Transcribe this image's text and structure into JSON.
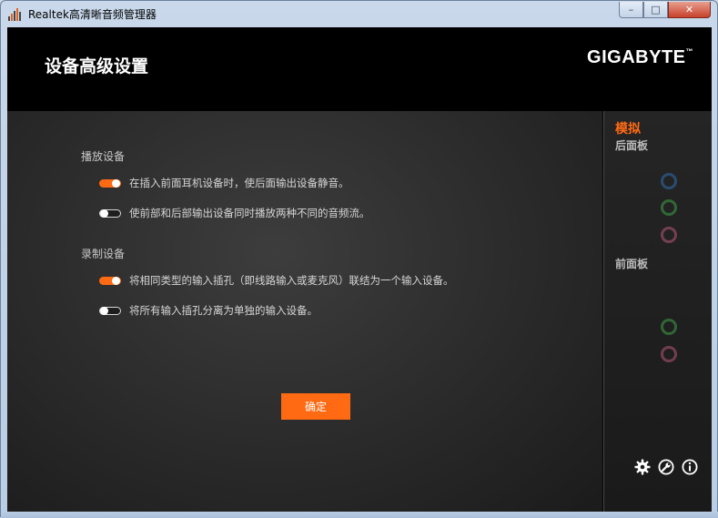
{
  "window": {
    "title": "Realtek高清晰音频管理器",
    "controls": {
      "minimize": "–",
      "maximize": "□",
      "close": "✕"
    }
  },
  "header": {
    "title": "设备高级设置",
    "logo": "GIGABYTE",
    "logo_mark": "™"
  },
  "playback": {
    "section_label": "播放设备",
    "options": [
      {
        "label": "在插入前面耳机设备时，使后面输出设备静音。",
        "state": "on"
      },
      {
        "label": "使前部和后部输出设备同时播放两种不同的音频流。",
        "state": "off"
      }
    ]
  },
  "recording": {
    "section_label": "录制设备",
    "options": [
      {
        "label": "将相同类型的输入插孔（即线路输入或麦克风）联结为一个输入设备。",
        "state": "on"
      },
      {
        "label": "将所有输入插孔分离为单独的输入设备。",
        "state": "off"
      }
    ]
  },
  "ok_button": "确定",
  "sidebar": {
    "tab": "模拟",
    "rear_panel": "后面板",
    "front_panel": "前面板",
    "rear_jacks": [
      "blue-jack",
      "green-jack",
      "pink-jack"
    ],
    "front_jacks": [
      "green-jack",
      "pink-jack"
    ]
  },
  "colors": {
    "accent": "#ff6a13",
    "jack_blue": "#2f6fb0",
    "jack_green": "#3fa048",
    "jack_pink": "#b85878"
  },
  "bottom_icons": [
    "gear-icon",
    "wrench-icon",
    "info-icon"
  ]
}
